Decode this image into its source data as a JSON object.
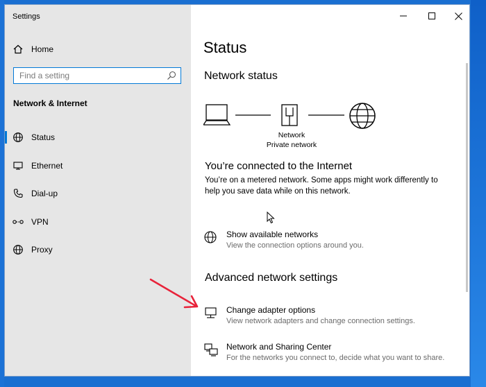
{
  "window": {
    "title": "Settings"
  },
  "sidebar": {
    "home_label": "Home",
    "search_placeholder": "Find a setting",
    "section_label": "Network & Internet",
    "items": [
      {
        "label": "Status",
        "icon": "globe-icon",
        "active": true
      },
      {
        "label": "Ethernet",
        "icon": "ethernet-icon",
        "active": false
      },
      {
        "label": "Dial-up",
        "icon": "phone-icon",
        "active": false
      },
      {
        "label": "VPN",
        "icon": "vpn-icon",
        "active": false
      },
      {
        "label": "Proxy",
        "icon": "globe-icon",
        "active": false
      }
    ]
  },
  "main": {
    "title": "Status",
    "network_status_heading": "Network status",
    "diagram": {
      "network_label": "Network",
      "network_type": "Private network"
    },
    "connected_heading": "You’re connected to the Internet",
    "connected_desc_line1": "You’re on a metered network. Some apps might work differently to",
    "connected_desc_line2": "help you save data while on this network.",
    "links": [
      {
        "title": "Show available networks",
        "desc": "View the connection options around you."
      }
    ],
    "advanced_heading": "Advanced network settings",
    "advanced_links": [
      {
        "title": "Change adapter options",
        "desc": "View network adapters and change connection settings."
      },
      {
        "title": "Network and Sharing Center",
        "desc": "For the networks you connect to, decide what you want to share."
      }
    ]
  },
  "colors": {
    "accent": "#0078d7",
    "annotation_arrow": "#e8233a",
    "sidebar_bg": "#e6e6e6"
  }
}
